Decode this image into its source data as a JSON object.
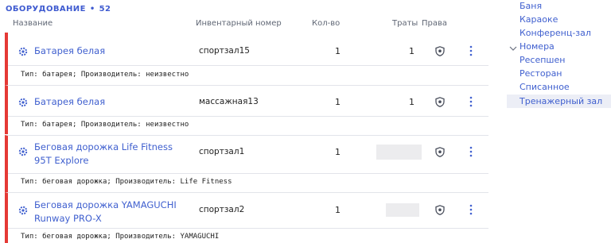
{
  "heading": {
    "title": "ОБОРУДОВАНИЕ",
    "separator": "•",
    "count": "52"
  },
  "columns": {
    "name": "Название",
    "inventory": "Инвентарный номер",
    "qty": "Кол-во",
    "cost": "Траты",
    "rights": "Права"
  },
  "rows": [
    {
      "name": "Батарея белая",
      "inventory": "спортзал15",
      "qty": "1",
      "cost": "1",
      "desc": "Тип: батарея; Производитель: неизвестно"
    },
    {
      "name": "Батарея белая",
      "inventory": "массажная13",
      "qty": "1",
      "cost": "1",
      "desc": "Тип: батарея; Производитель: неизвестно"
    },
    {
      "name_line1": "Беговая дорожка Life Fitness",
      "name_line2": "95T Explore",
      "inventory": "спортзал1",
      "qty": "1",
      "cost": "",
      "desc": "Тип: беговая дорожка; Производитель: Life Fitness"
    },
    {
      "name_line1": "Беговая дорожка YAMAGUCHI",
      "name_line2": "Runway PRO-X",
      "inventory": "спортзал2",
      "qty": "1",
      "cost": "",
      "desc": "Тип: беговая дорожка; Производитель: YAMAGUCHI"
    }
  ],
  "sidebar": {
    "items": [
      "Баня",
      "Караоке",
      "Конференц-зал",
      "Номера",
      "Ресепшен",
      "Ресторан",
      "Списанное",
      "Тренажерный зал"
    ],
    "active": "Тренажерный зал"
  },
  "icons": {
    "item": "gear-item-icon",
    "rights": "shield-icon",
    "menu": "kebab-menu-icon",
    "expand": "chevron-down-icon"
  },
  "colors": {
    "accent": "#4060cf",
    "row_marker": "#e53935",
    "active_bg": "#eceef6"
  }
}
